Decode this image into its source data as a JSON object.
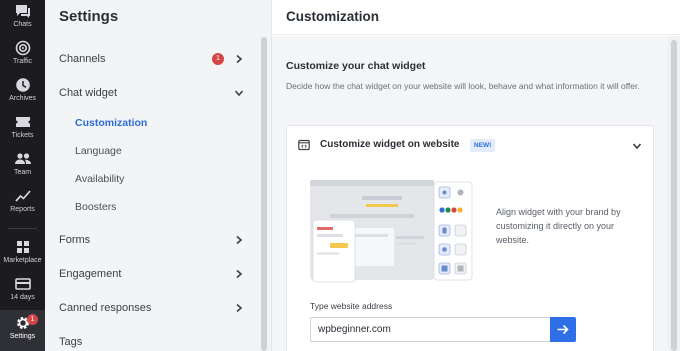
{
  "rail": {
    "items": [
      {
        "label": "Chats",
        "icon": "chat-bubble-icon"
      },
      {
        "label": "Traffic",
        "icon": "traffic-radar-icon"
      },
      {
        "label": "Archives",
        "icon": "clock-icon"
      },
      {
        "label": "Tickets",
        "icon": "ticket-icon"
      },
      {
        "label": "Team",
        "icon": "team-icon"
      },
      {
        "label": "Reports",
        "icon": "chart-line-icon"
      },
      {
        "label": "Marketplace",
        "icon": "marketplace-grid-icon"
      },
      {
        "label": "14 days",
        "icon": "card-icon"
      },
      {
        "label": "Settings",
        "icon": "gear-icon",
        "badge": "1",
        "active": true
      }
    ]
  },
  "settings": {
    "title": "Settings",
    "channels": {
      "label": "Channels",
      "badge": "1"
    },
    "chat_widget": {
      "label": "Chat widget"
    },
    "sub": [
      "Customization",
      "Language",
      "Availability",
      "Boosters"
    ],
    "forms": "Forms",
    "engagement": "Engagement",
    "canned": "Canned responses",
    "tags": "Tags"
  },
  "main": {
    "title": "Customization",
    "section_title": "Customize your chat widget",
    "section_desc": "Decide how the chat widget on your website will look, behave and what information it will offer.",
    "card": {
      "title": "Customize widget on website",
      "new_badge": "NEW!",
      "description": "Align widget with your brand by customizing it directly on your website.",
      "address_label": "Type website address",
      "address_value": "wpbeginner.com"
    }
  },
  "colors": {
    "accent": "#2e6ee6",
    "badge": "#d64545",
    "rail_bg": "#1b1b20",
    "panel_bg": "#f3f4f6",
    "swatches": [
      "#2d6bd8",
      "#1f8a4c",
      "#d64545",
      "#f2b233"
    ]
  }
}
